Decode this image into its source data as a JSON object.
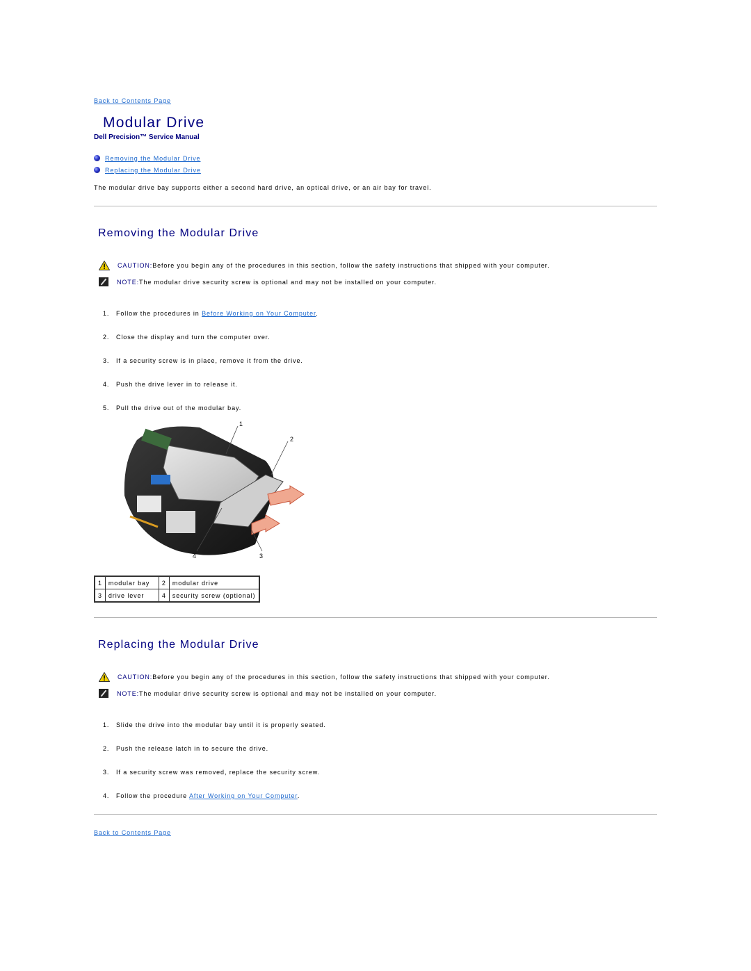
{
  "nav": {
    "back_link": "Back to Contents Page"
  },
  "header": {
    "title": "Modular Drive",
    "subtitle": "Dell Precision™ Service Manual"
  },
  "toc": [
    {
      "label": "Removing the Modular Drive"
    },
    {
      "label": "Replacing the Modular Drive"
    }
  ],
  "intro": "The modular drive bay supports either a second hard drive, an optical drive, or an air bay for travel.",
  "sections": [
    {
      "heading": "Removing the Modular Drive",
      "caution_label": "CAUTION:",
      "caution_text": " Before you begin any of the procedures in this section, follow the safety instructions that shipped with your computer.",
      "note_label": "NOTE:",
      "note_text": " The modular drive security screw is optional and may not be installed on your computer.",
      "steps": [
        {
          "num": "1.",
          "pre": "Follow the procedures in ",
          "link": "Before Working on Your Computer",
          "post": "."
        },
        {
          "num": "2.",
          "pre": "Close the display and turn the computer over.",
          "link": "",
          "post": ""
        },
        {
          "num": "3.",
          "pre": "If a security screw is in place, remove it from the drive.",
          "link": "",
          "post": ""
        },
        {
          "num": "4.",
          "pre": "Push the drive lever in to release it.",
          "link": "",
          "post": ""
        },
        {
          "num": "5.",
          "pre": "Pull the drive out of the modular bay.",
          "link": "",
          "post": ""
        }
      ],
      "figure": {
        "callouts": [
          "1",
          "2",
          "3",
          "4"
        ],
        "legend": [
          [
            {
              "n": "1",
              "label": "modular bay"
            },
            {
              "n": "2",
              "label": "modular drive"
            }
          ],
          [
            {
              "n": "3",
              "label": "drive lever"
            },
            {
              "n": "4",
              "label": "security screw (optional)"
            }
          ]
        ]
      }
    },
    {
      "heading": "Replacing the Modular Drive",
      "caution_label": "CAUTION:",
      "caution_text": " Before you begin any of the procedures in this section, follow the safety instructions that shipped with your computer.",
      "note_label": "NOTE:",
      "note_text": " The modular drive security screw is optional and may not be installed on your computer.",
      "steps": [
        {
          "num": "1.",
          "pre": "Slide the drive into the modular bay until it is properly seated.",
          "link": "",
          "post": ""
        },
        {
          "num": "2.",
          "pre": "Push the release latch in to secure the drive.",
          "link": "",
          "post": ""
        },
        {
          "num": "3.",
          "pre": "If a security screw was removed, replace the security screw.",
          "link": "",
          "post": ""
        },
        {
          "num": "4.",
          "pre": "Follow the procedure ",
          "link": "After Working on Your Computer",
          "post": "."
        }
      ]
    }
  ]
}
